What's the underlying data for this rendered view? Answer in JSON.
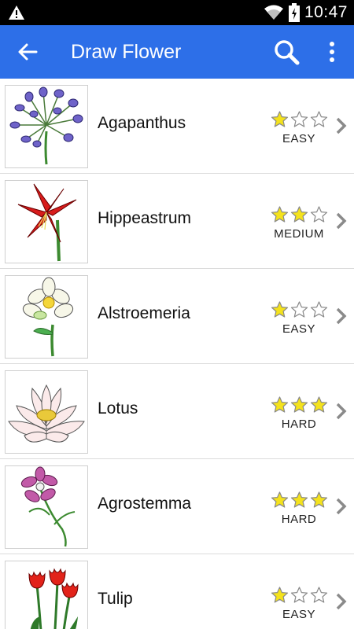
{
  "status_bar": {
    "time": "10:47"
  },
  "app_bar": {
    "title": "Draw Flower"
  },
  "flowers": [
    {
      "name": "Agapanthus",
      "difficulty": "EASY",
      "stars": 1,
      "max_stars": 3
    },
    {
      "name": "Hippeastrum",
      "difficulty": "MEDIUM",
      "stars": 2,
      "max_stars": 3
    },
    {
      "name": "Alstroemeria",
      "difficulty": "EASY",
      "stars": 1,
      "max_stars": 3
    },
    {
      "name": "Lotus",
      "difficulty": "HARD",
      "stars": 3,
      "max_stars": 3
    },
    {
      "name": "Agrostemma",
      "difficulty": "HARD",
      "stars": 3,
      "max_stars": 3
    },
    {
      "name": "Tulip",
      "difficulty": "EASY",
      "stars": 1,
      "max_stars": 3
    }
  ],
  "colors": {
    "app_bar": "#2d6fe8",
    "star_filled": "#f4e21c",
    "star_outline": "#888888"
  }
}
